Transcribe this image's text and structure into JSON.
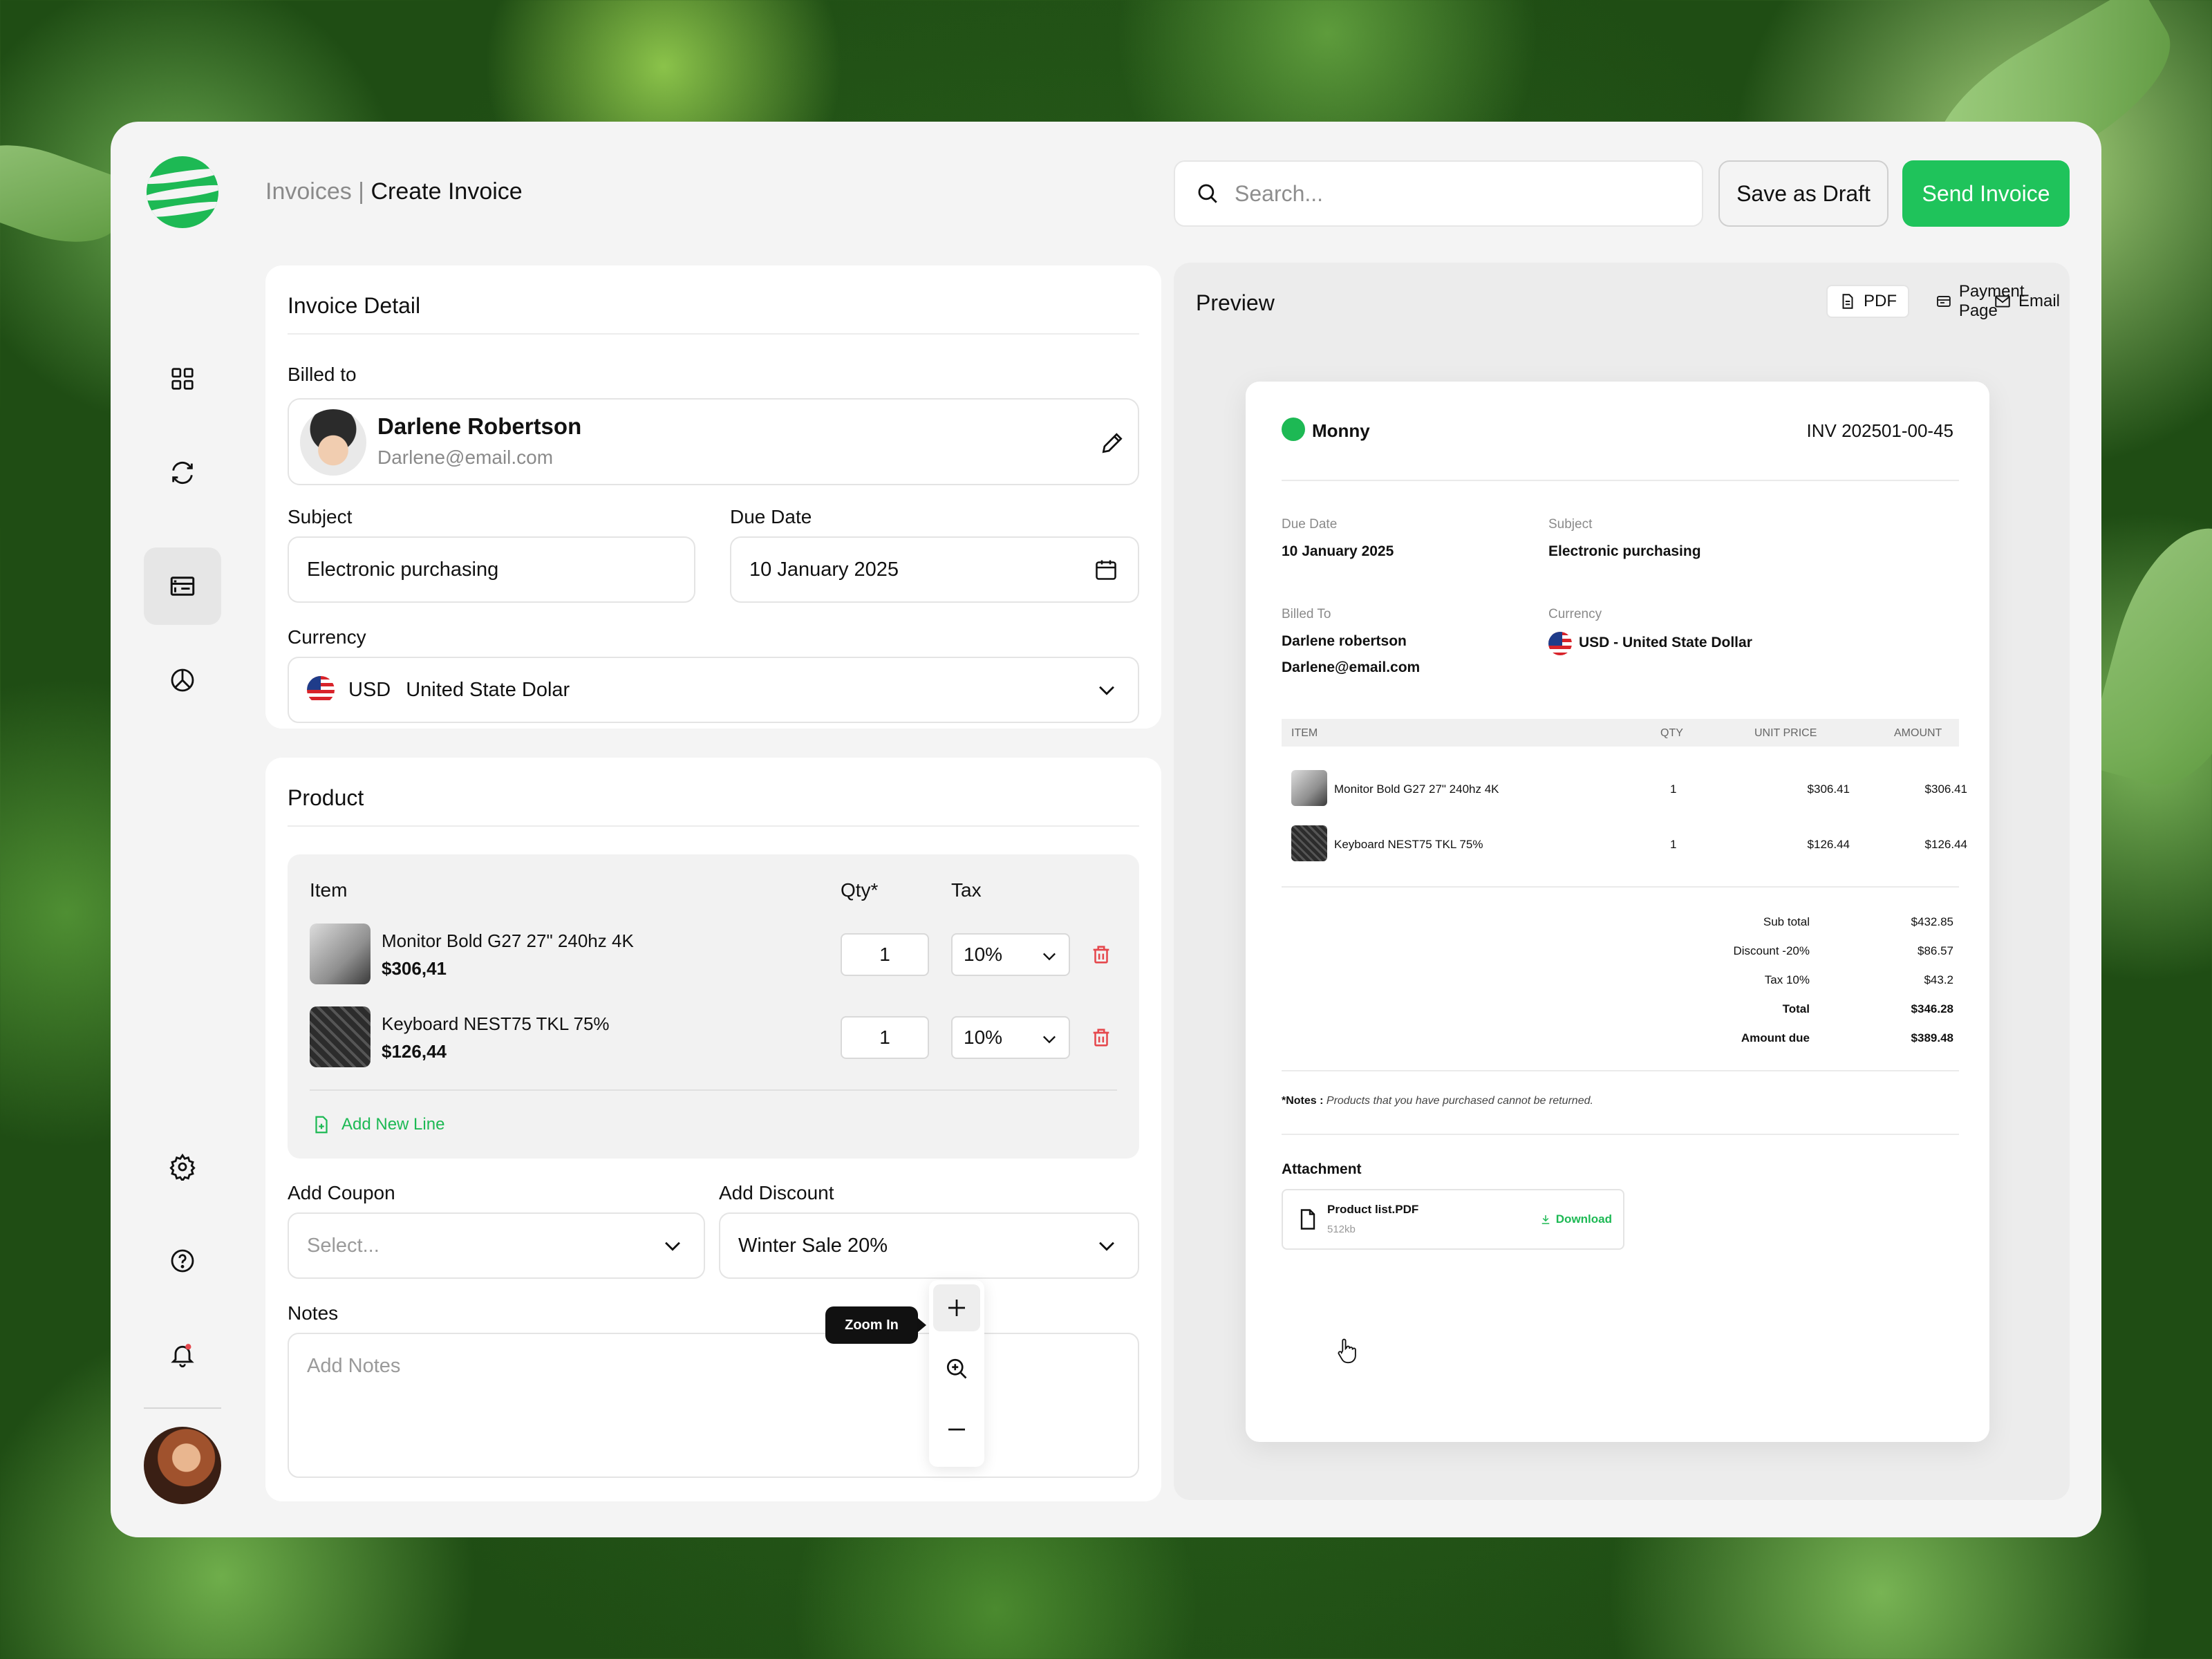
{
  "header": {
    "breadcrumb_parent": "Invoices |",
    "breadcrumb_current": "Create Invoice",
    "search_placeholder": "Search...",
    "save_draft_label": "Save as Draft",
    "send_label": "Send Invoice"
  },
  "sidebar": {
    "items": [
      {
        "icon": "grid-icon",
        "active": false
      },
      {
        "icon": "refresh-icon",
        "active": false
      },
      {
        "icon": "wallet-icon",
        "active": false
      },
      {
        "icon": "invoice-icon",
        "active": true
      },
      {
        "icon": "pie-chart-icon",
        "active": false
      }
    ],
    "bottom": [
      "settings-icon",
      "help-icon",
      "bell-icon"
    ]
  },
  "invoice_detail": {
    "title": "Invoice Detail",
    "billed_to_label": "Billed to",
    "client_name": "Darlene Robertson",
    "client_email": "Darlene@email.com",
    "subject_label": "Subject",
    "subject_value": "Electronic purchasing",
    "due_label": "Due Date",
    "due_value": "10 January 2025",
    "currency_label": "Currency",
    "currency_code": "USD",
    "currency_name": "United State Dolar"
  },
  "product": {
    "title": "Product",
    "col_item": "Item",
    "col_qty": "Qty*",
    "col_tax": "Tax",
    "items": [
      {
        "name": "Monitor Bold G27 27\" 240hz 4K",
        "price": "$306,41",
        "qty": "1",
        "tax": "10%"
      },
      {
        "name": "Keyboard NEST75 TKL 75%",
        "price": "$126,44",
        "qty": "1",
        "tax": "10%"
      }
    ],
    "add_line": "Add New Line",
    "coupon_label": "Add Coupon",
    "coupon_placeholder": "Select...",
    "discount_label": "Add Discount",
    "discount_value": "Winter Sale 20%",
    "notes_label": "Notes",
    "notes_placeholder": "Add Notes"
  },
  "preview": {
    "title": "Preview",
    "tabs": [
      "PDF",
      "Payment Page",
      "Email"
    ],
    "doc": {
      "brand": "Monny",
      "invoice_no": "INV 202501-00-45",
      "due_label": "Due Date",
      "due_value": "10 January 2025",
      "subject_label": "Subject",
      "subject_value": "Electronic purchasing",
      "billed_label": "Billed To",
      "billed_name": "Darlene robertson",
      "billed_email": "Darlene@email.com",
      "currency_label": "Currency",
      "currency_value": "USD - United State Dollar",
      "th_item": "ITEM",
      "th_qty": "QTY",
      "th_unit": "UNIT PRICE",
      "th_amount": "AMOUNT",
      "rows": [
        {
          "name": "Monitor Bold G27 27\" 240hz 4K",
          "qty": "1",
          "unit": "$306.41",
          "amount": "$306.41"
        },
        {
          "name": "Keyboard NEST75 TKL 75%",
          "qty": "1",
          "unit": "$126.44",
          "amount": "$126.44"
        }
      ],
      "totals": [
        {
          "label": "Sub total",
          "value": "$432.85",
          "bold": false
        },
        {
          "label": "Discount -20%",
          "value": "$86.57",
          "bold": false
        },
        {
          "label": "Tax 10%",
          "value": "$43.2",
          "bold": false
        },
        {
          "label": "Total",
          "value": "$346.28",
          "bold": true
        },
        {
          "label": "Amount due",
          "value": "$389.48",
          "bold": true
        }
      ],
      "notes_label": "*Notes :",
      "notes_text": "Products that you have purchased cannot be returned.",
      "attachment_label": "Attachment",
      "file_name": "Product list.PDF",
      "file_size": "512kb",
      "download_label": "Download"
    },
    "zoom_tooltip": "Zoom In"
  },
  "colors": {
    "accent": "#1fc35b",
    "danger": "#e5484d"
  }
}
